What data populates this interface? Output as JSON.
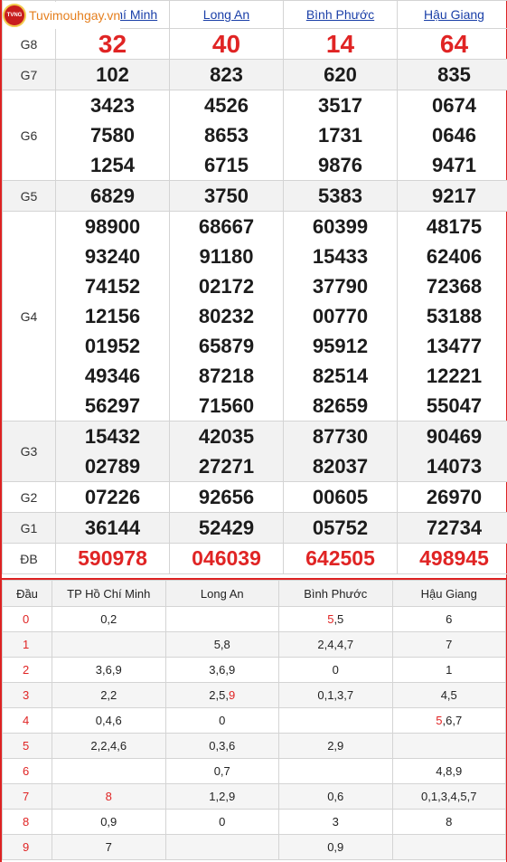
{
  "logo": {
    "text": "Tuvimouhgay.vn",
    "badge": "TVNG"
  },
  "provinces": [
    "TP Hồ Chí Minh",
    "Long An",
    "Bình Phước",
    "Hậu Giang"
  ],
  "prizes": [
    {
      "label": "G8",
      "cls": "g8",
      "values": [
        [
          "32"
        ],
        [
          "40"
        ],
        [
          "14"
        ],
        [
          "64"
        ]
      ]
    },
    {
      "label": "G7",
      "cls": "",
      "values": [
        [
          "102"
        ],
        [
          "823"
        ],
        [
          "620"
        ],
        [
          "835"
        ]
      ]
    },
    {
      "label": "G6",
      "cls": "",
      "values": [
        [
          "3423",
          "7580",
          "1254"
        ],
        [
          "4526",
          "8653",
          "6715"
        ],
        [
          "3517",
          "1731",
          "9876"
        ],
        [
          "0674",
          "0646",
          "9471"
        ]
      ]
    },
    {
      "label": "G5",
      "cls": "",
      "values": [
        [
          "6829"
        ],
        [
          "3750"
        ],
        [
          "5383"
        ],
        [
          "9217"
        ]
      ]
    },
    {
      "label": "G4",
      "cls": "",
      "values": [
        [
          "98900",
          "93240",
          "74152",
          "12156",
          "01952",
          "49346",
          "56297"
        ],
        [
          "68667",
          "91180",
          "02172",
          "80232",
          "65879",
          "87218",
          "71560"
        ],
        [
          "60399",
          "15433",
          "37790",
          "00770",
          "95912",
          "82514",
          "82659"
        ],
        [
          "48175",
          "62406",
          "72368",
          "53188",
          "13477",
          "12221",
          "55047"
        ]
      ]
    },
    {
      "label": "G3",
      "cls": "",
      "values": [
        [
          "15432",
          "02789"
        ],
        [
          "42035",
          "27271"
        ],
        [
          "87730",
          "82037"
        ],
        [
          "90469",
          "14073"
        ]
      ]
    },
    {
      "label": "G2",
      "cls": "",
      "values": [
        [
          "07226"
        ],
        [
          "92656"
        ],
        [
          "00605"
        ],
        [
          "26970"
        ]
      ]
    },
    {
      "label": "G1",
      "cls": "",
      "values": [
        [
          "36144"
        ],
        [
          "52429"
        ],
        [
          "05752"
        ],
        [
          "72734"
        ]
      ]
    },
    {
      "label": "ĐB",
      "cls": "db",
      "values": [
        [
          "590978"
        ],
        [
          "046039"
        ],
        [
          "642505"
        ],
        [
          "498945"
        ]
      ]
    }
  ],
  "dau_table": {
    "header": [
      "Đầu",
      "TP Hồ Chí Minh",
      "Long An",
      "Bình Phước",
      "Hậu Giang"
    ],
    "rows": [
      {
        "d": "0",
        "c": [
          [
            [
              "0,2",
              ""
            ]
          ],
          [],
          [
            [
              "5",
              "r"
            ],
            [
              ",5",
              ""
            ]
          ],
          [
            [
              "6",
              ""
            ]
          ]
        ]
      },
      {
        "d": "1",
        "c": [
          [],
          [
            [
              "5,8",
              ""
            ]
          ],
          [
            [
              "2,4,4,7",
              ""
            ]
          ],
          [
            [
              "7",
              ""
            ]
          ]
        ]
      },
      {
        "d": "2",
        "c": [
          [
            [
              "3,6,9",
              ""
            ]
          ],
          [
            [
              "3,6,9",
              ""
            ]
          ],
          [
            [
              "0",
              ""
            ]
          ],
          [
            [
              "1",
              ""
            ]
          ]
        ]
      },
      {
        "d": "3",
        "c": [
          [
            [
              "2,2",
              ""
            ]
          ],
          [
            [
              "2,5,",
              ""
            ],
            [
              "9",
              "r"
            ]
          ],
          [
            [
              "0,1,3,7",
              ""
            ]
          ],
          [
            [
              "4,5",
              ""
            ]
          ]
        ]
      },
      {
        "d": "4",
        "c": [
          [
            [
              "0,4,6",
              ""
            ]
          ],
          [
            [
              "0",
              ""
            ]
          ],
          [],
          [
            [
              "5",
              "r"
            ],
            [
              ",6,7",
              ""
            ]
          ]
        ]
      },
      {
        "d": "5",
        "c": [
          [
            [
              "2,2,4,6",
              ""
            ]
          ],
          [
            [
              "0,3,6",
              ""
            ]
          ],
          [
            [
              "2,9",
              ""
            ]
          ],
          []
        ]
      },
      {
        "d": "6",
        "c": [
          [],
          [
            [
              "0,7",
              ""
            ]
          ],
          [],
          [
            [
              "4,8,9",
              ""
            ]
          ]
        ]
      },
      {
        "d": "7",
        "c": [
          [
            [
              "8",
              "r"
            ]
          ],
          [
            [
              "1,2,9",
              ""
            ]
          ],
          [
            [
              "0,6",
              ""
            ]
          ],
          [
            [
              "0,1,3,4,5,7",
              ""
            ]
          ]
        ]
      },
      {
        "d": "8",
        "c": [
          [
            [
              "0,9",
              ""
            ]
          ],
          [
            [
              "0",
              ""
            ]
          ],
          [
            [
              "3",
              ""
            ]
          ],
          [
            [
              "8",
              ""
            ]
          ]
        ]
      },
      {
        "d": "9",
        "c": [
          [
            [
              "7",
              ""
            ]
          ],
          [],
          [
            [
              "0,9",
              ""
            ]
          ],
          []
        ]
      }
    ]
  },
  "colors": {
    "red": "#e02424",
    "link": "#1a3fa8",
    "border": "#d22"
  }
}
